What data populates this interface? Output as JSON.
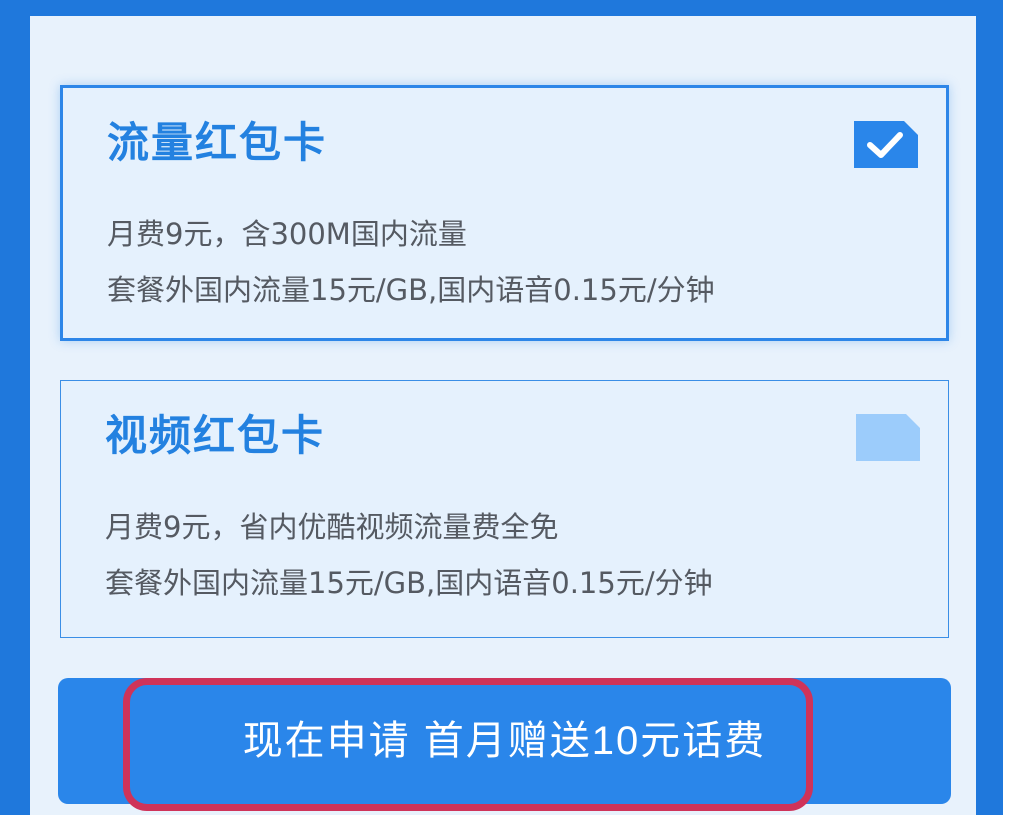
{
  "plans": [
    {
      "title": "流量红包卡",
      "line1": "月费9元，含300M国内流量",
      "line2": "套餐外国内流量15元/GB,国内语音0.15元/分钟",
      "selected": true
    },
    {
      "title": "视频红包卡",
      "line1": "月费9元，省内优酷视频流量费全免",
      "line2": "套餐外国内流量15元/GB,国内语音0.15元/分钟",
      "selected": false
    }
  ],
  "apply_button": {
    "label": "现在申请 首月赠送10元话费"
  },
  "colors": {
    "frame": "#1f78dc",
    "panel": "#e8f2fc",
    "accent": "#2381e0",
    "button": "#2a86ea",
    "highlight": "#cf3359",
    "checkbox_on": "#2a86ea",
    "checkbox_off": "#9cccfb"
  },
  "icons": {
    "checked": "checkbox-checked-icon",
    "unchecked": "checkbox-unchecked-icon"
  }
}
